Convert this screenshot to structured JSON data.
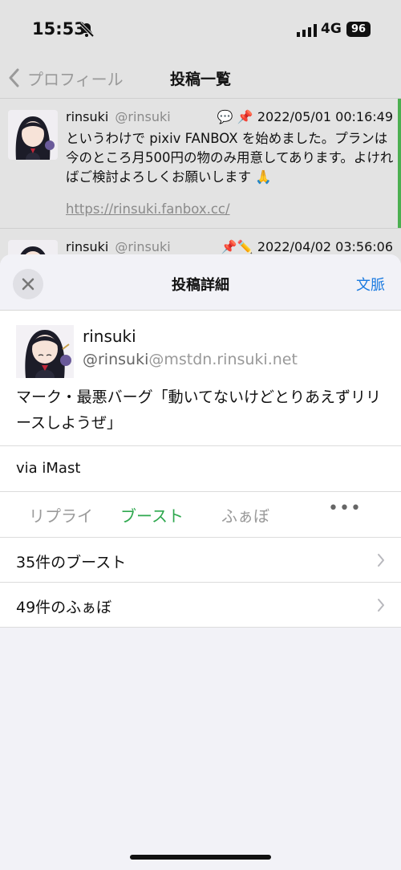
{
  "status_bar": {
    "time": "15:53",
    "network": "4G",
    "battery": "96"
  },
  "nav": {
    "back_label": "プロフィール",
    "title": "投稿一覧"
  },
  "timeline": [
    {
      "name": "rinsuki",
      "handle": "@rinsuki",
      "icons": "💬 📌",
      "date": "2022/05/01 00:16:49",
      "body": "というわけで pixiv FANBOX を始めました。プランは今のところ月500円の物のみ用意してあります。よければご検討よろしくお願いします 🙏",
      "link": "https://rinsuki.fanbox.cc/"
    },
    {
      "name": "rinsuki",
      "handle": "@rinsuki",
      "icons": "📌✏️",
      "date": "2022/04/02 03:56:06"
    }
  ],
  "sheet": {
    "title": "投稿詳細",
    "context_label": "文脈",
    "author_name": "rinsuki",
    "author_handle": "@rinsuki",
    "author_domain": "@mstdn.rinsuki.net",
    "body": "マーク・最悪バーグ「動いてないけどとりあえずリリースしようぜ」",
    "via": "via iMast",
    "actions": {
      "reply": "リプライ",
      "boost": "ブースト",
      "fav": "ふぁぼ",
      "more": "•••"
    },
    "boost_count_label": "35件のブースト",
    "fav_count_label": "49件のふぁぼ"
  },
  "colors": {
    "accent_blue": "#1a7ae0",
    "boost_green": "#2fa84f",
    "thread_bar": "#4caf50"
  }
}
